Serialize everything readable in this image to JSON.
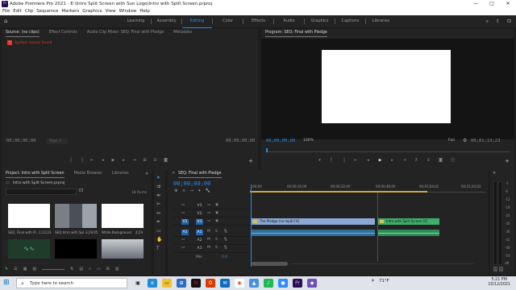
{
  "titlebar": {
    "title": "Adobe Premiere Pro 2021 - E:\\Intro Split Screen with Sun Logo\\Intro with Split Screen.prproj",
    "minimize": "—",
    "maximize": "□",
    "close": "✕",
    "logo": "Pr"
  },
  "menu": [
    "File",
    "Edit",
    "Clip",
    "Sequence",
    "Markers",
    "Graphics",
    "View",
    "Window",
    "Help"
  ],
  "workspaces": [
    "Learning",
    "Assembly",
    "Editing",
    "Color",
    "Effects",
    "Audio",
    "Graphics",
    "Captions",
    "Libraries"
  ],
  "workspace_active": "Editing",
  "source_panel": {
    "tabs": [
      "Source: (no clips)",
      "Effect Controls",
      "Audio Clip Mixer: SEQ: Final with Pledge",
      "Metadata"
    ],
    "alert": "System issues found",
    "timecode_left": "00;00;00;00",
    "page": "Page 1",
    "timecode_right": "00;00;00;00"
  },
  "program_panel": {
    "title": "Program: SEQ: Final with Pledge",
    "timecode": "00;00;00;00",
    "zoom": "100%",
    "quality": "Full",
    "duration": "00;01;13;23"
  },
  "project_panel": {
    "tabs": [
      "Project: Intro with Split Screen",
      "Media Browser",
      "Libraries"
    ],
    "file": "Intro with Split Screen.prproj",
    "items_count": "18 Items",
    "items": [
      {
        "name": "SEQ: Final with Pl...",
        "dur": "1;13;23"
      },
      {
        "name": "SEQ:Intro with Spl...",
        "dur": "3;29;05"
      },
      {
        "name": "White Background",
        "dur": "4;29"
      }
    ]
  },
  "timeline": {
    "title": "SEQ: Final with Pledge",
    "timecode": "00;00;00;00",
    "ruler": [
      ":00;00",
      "00;00;16;00",
      "00;00;32;00",
      "00;00;48;00",
      "00;01;04;02",
      "00;01;20;02"
    ],
    "tracks": [
      {
        "name": "V3"
      },
      {
        "name": "V2"
      },
      {
        "name": "V1"
      },
      {
        "name": "A1"
      },
      {
        "name": "A2"
      },
      {
        "name": "A3"
      }
    ],
    "mix_label": "Mix",
    "mix_value": "0.0",
    "clips": [
      {
        "label": "The Pledge (no mp4) [V]"
      },
      {
        "label": "Intro with Split Screen [V]"
      }
    ]
  },
  "meters": {
    "labels": [
      "0",
      "-6",
      "-12",
      "-18",
      "-24",
      "-30",
      "-36",
      "-42",
      "-48",
      "-54",
      "dB"
    ],
    "solo": "S",
    "solo2": "S"
  },
  "taskbar": {
    "search": "Type here to search",
    "weather": "71°F",
    "time": "5:21 PM",
    "date": "10/12/2021"
  },
  "colors": {
    "accent": "#2d8ceb",
    "video_clip": "#8aa7d6",
    "audio_clip": "#3fae6b",
    "alert": "#e0382c"
  }
}
